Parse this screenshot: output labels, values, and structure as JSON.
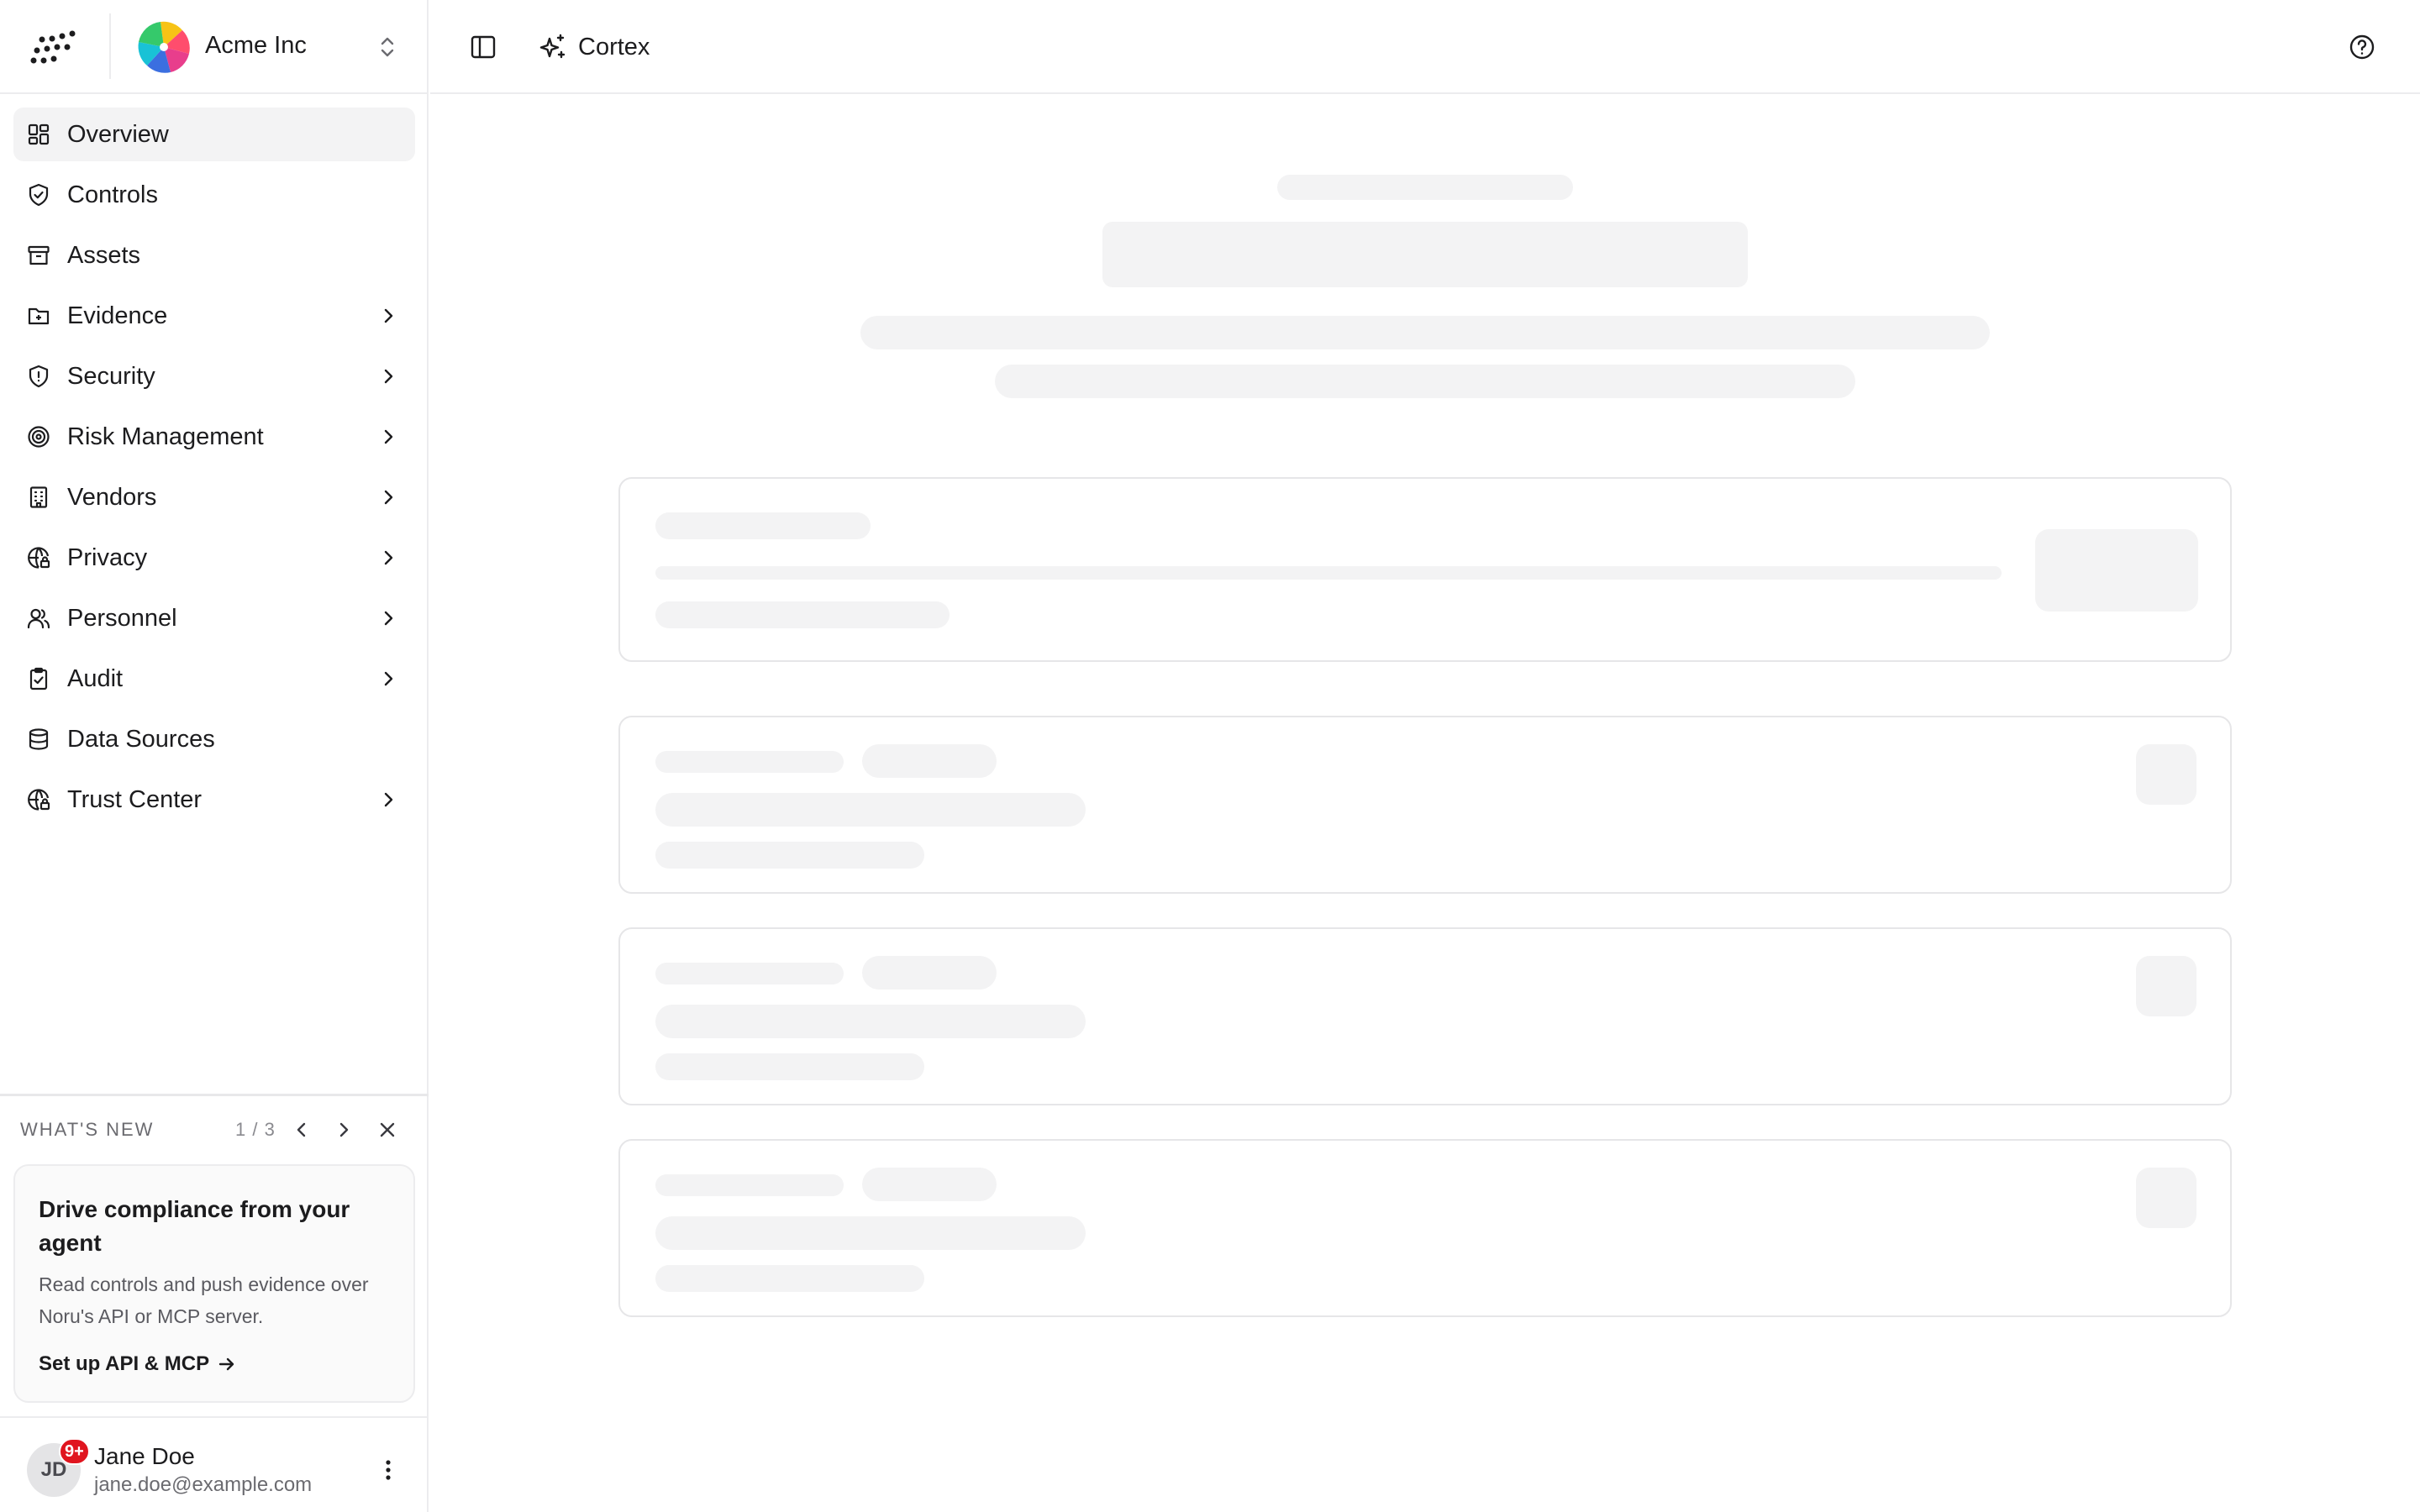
{
  "org": {
    "name": "Acme Inc"
  },
  "topbar": {
    "cortex_label": "Cortex"
  },
  "sidebar": {
    "items": [
      {
        "label": "Overview",
        "icon": "dashboard-icon",
        "active": true,
        "has_chevron": false
      },
      {
        "label": "Controls",
        "icon": "shield-check-icon",
        "active": false,
        "has_chevron": false
      },
      {
        "label": "Assets",
        "icon": "archive-box-icon",
        "active": false,
        "has_chevron": false
      },
      {
        "label": "Evidence",
        "icon": "folder-file-icon",
        "active": false,
        "has_chevron": true
      },
      {
        "label": "Security",
        "icon": "shield-alert-icon",
        "active": false,
        "has_chevron": true
      },
      {
        "label": "Risk Management",
        "icon": "target-icon",
        "active": false,
        "has_chevron": true
      },
      {
        "label": "Vendors",
        "icon": "building-icon",
        "active": false,
        "has_chevron": true
      },
      {
        "label": "Privacy",
        "icon": "globe-lock-icon",
        "active": false,
        "has_chevron": true
      },
      {
        "label": "Personnel",
        "icon": "users-icon",
        "active": false,
        "has_chevron": true
      },
      {
        "label": "Audit",
        "icon": "clipboard-check-icon",
        "active": false,
        "has_chevron": true
      },
      {
        "label": "Data Sources",
        "icon": "database-icon",
        "active": false,
        "has_chevron": false
      },
      {
        "label": "Trust Center",
        "icon": "globe-lock-icon",
        "active": false,
        "has_chevron": true
      }
    ]
  },
  "whats_new": {
    "title": "WHAT'S NEW",
    "counter": "1 / 3",
    "card_title": "Drive compliance from your agent",
    "card_body": "Read controls and push evidence over Noru's API or MCP server.",
    "card_link": "Set up API & MCP"
  },
  "user": {
    "initials": "JD",
    "badge": "9+",
    "name": "Jane Doe",
    "email": "jane.doe@example.com"
  },
  "colors": {
    "skeleton": "#f3f3f4",
    "active_nav_bg": "#f3f3f4",
    "badge": "#e0151f",
    "border": "#ececee"
  }
}
